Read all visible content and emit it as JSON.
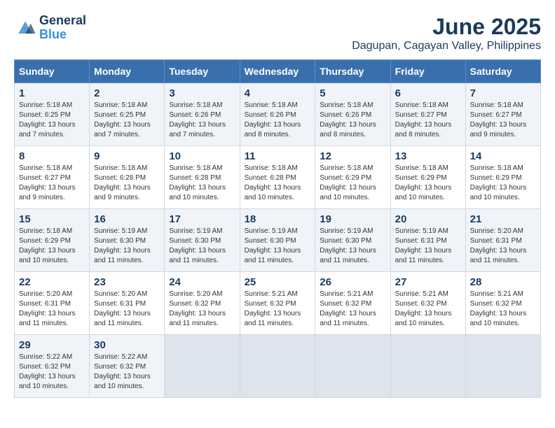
{
  "logo": {
    "line1": "General",
    "line2": "Blue"
  },
  "title": "June 2025",
  "subtitle": "Dagupan, Cagayan Valley, Philippines",
  "days_of_week": [
    "Sunday",
    "Monday",
    "Tuesday",
    "Wednesday",
    "Thursday",
    "Friday",
    "Saturday"
  ],
  "weeks": [
    [
      {
        "day": "1",
        "rise": "5:18 AM",
        "set": "6:25 PM",
        "daylight": "13 hours and 7 minutes."
      },
      {
        "day": "2",
        "rise": "5:18 AM",
        "set": "6:25 PM",
        "daylight": "13 hours and 7 minutes."
      },
      {
        "day": "3",
        "rise": "5:18 AM",
        "set": "6:26 PM",
        "daylight": "13 hours and 7 minutes."
      },
      {
        "day": "4",
        "rise": "5:18 AM",
        "set": "6:26 PM",
        "daylight": "13 hours and 8 minutes."
      },
      {
        "day": "5",
        "rise": "5:18 AM",
        "set": "6:26 PM",
        "daylight": "13 hours and 8 minutes."
      },
      {
        "day": "6",
        "rise": "5:18 AM",
        "set": "6:27 PM",
        "daylight": "13 hours and 8 minutes."
      },
      {
        "day": "7",
        "rise": "5:18 AM",
        "set": "6:27 PM",
        "daylight": "13 hours and 9 minutes."
      }
    ],
    [
      {
        "day": "8",
        "rise": "5:18 AM",
        "set": "6:27 PM",
        "daylight": "13 hours and 9 minutes."
      },
      {
        "day": "9",
        "rise": "5:18 AM",
        "set": "6:28 PM",
        "daylight": "13 hours and 9 minutes."
      },
      {
        "day": "10",
        "rise": "5:18 AM",
        "set": "6:28 PM",
        "daylight": "13 hours and 10 minutes."
      },
      {
        "day": "11",
        "rise": "5:18 AM",
        "set": "6:28 PM",
        "daylight": "13 hours and 10 minutes."
      },
      {
        "day": "12",
        "rise": "5:18 AM",
        "set": "6:29 PM",
        "daylight": "13 hours and 10 minutes."
      },
      {
        "day": "13",
        "rise": "5:18 AM",
        "set": "6:29 PM",
        "daylight": "13 hours and 10 minutes."
      },
      {
        "day": "14",
        "rise": "5:18 AM",
        "set": "6:29 PM",
        "daylight": "13 hours and 10 minutes."
      }
    ],
    [
      {
        "day": "15",
        "rise": "5:18 AM",
        "set": "6:29 PM",
        "daylight": "13 hours and 10 minutes."
      },
      {
        "day": "16",
        "rise": "5:19 AM",
        "set": "6:30 PM",
        "daylight": "13 hours and 11 minutes."
      },
      {
        "day": "17",
        "rise": "5:19 AM",
        "set": "6:30 PM",
        "daylight": "13 hours and 11 minutes."
      },
      {
        "day": "18",
        "rise": "5:19 AM",
        "set": "6:30 PM",
        "daylight": "13 hours and 11 minutes."
      },
      {
        "day": "19",
        "rise": "5:19 AM",
        "set": "6:30 PM",
        "daylight": "13 hours and 11 minutes."
      },
      {
        "day": "20",
        "rise": "5:19 AM",
        "set": "6:31 PM",
        "daylight": "13 hours and 11 minutes."
      },
      {
        "day": "21",
        "rise": "5:20 AM",
        "set": "6:31 PM",
        "daylight": "13 hours and 11 minutes."
      }
    ],
    [
      {
        "day": "22",
        "rise": "5:20 AM",
        "set": "6:31 PM",
        "daylight": "13 hours and 11 minutes."
      },
      {
        "day": "23",
        "rise": "5:20 AM",
        "set": "6:31 PM",
        "daylight": "13 hours and 11 minutes."
      },
      {
        "day": "24",
        "rise": "5:20 AM",
        "set": "6:32 PM",
        "daylight": "13 hours and 11 minutes."
      },
      {
        "day": "25",
        "rise": "5:21 AM",
        "set": "6:32 PM",
        "daylight": "13 hours and 11 minutes."
      },
      {
        "day": "26",
        "rise": "5:21 AM",
        "set": "6:32 PM",
        "daylight": "13 hours and 11 minutes."
      },
      {
        "day": "27",
        "rise": "5:21 AM",
        "set": "6:32 PM",
        "daylight": "13 hours and 10 minutes."
      },
      {
        "day": "28",
        "rise": "5:21 AM",
        "set": "6:32 PM",
        "daylight": "13 hours and 10 minutes."
      }
    ],
    [
      {
        "day": "29",
        "rise": "5:22 AM",
        "set": "6:32 PM",
        "daylight": "13 hours and 10 minutes."
      },
      {
        "day": "30",
        "rise": "5:22 AM",
        "set": "6:32 PM",
        "daylight": "13 hours and 10 minutes."
      },
      null,
      null,
      null,
      null,
      null
    ]
  ]
}
